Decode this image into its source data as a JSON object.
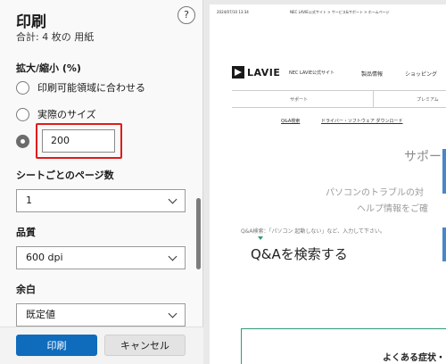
{
  "panel": {
    "title": "印刷",
    "subtitle": "合計: 4 枚の 用紙",
    "help_label": "?",
    "scale": {
      "label": "拡大/縮小 (%)",
      "options": [
        {
          "label": "印刷可能領域に合わせる",
          "checked": false
        },
        {
          "label": "実際のサイズ",
          "checked": false
        },
        {
          "label": "",
          "checked": true
        }
      ],
      "custom_value": "200"
    },
    "pages_per_sheet": {
      "label": "シートごとのページ数",
      "value": "1"
    },
    "quality": {
      "label": "品質",
      "value": "600 dpi"
    },
    "margins": {
      "label": "余白",
      "value": "既定値"
    },
    "print_button": "印刷",
    "cancel_button": "キャンセル"
  },
  "preview": {
    "header_left": "2024/07/10 13:34",
    "header_center": "NEC LAVIE公式サイト > サービス&サポート > ホームページ",
    "logo_text": "LAVIE",
    "site_name": "NEC LAVIE公式サイト",
    "nav_items": [
      "製品情報",
      "ショッピング"
    ],
    "subnav_items": [
      "サポート",
      "プレミアム"
    ],
    "links": [
      "Q&A検索",
      "ドライバー・ソフトウェア ダウンロード"
    ],
    "support_heading": "サポー",
    "tagline_line1": "パソコンのトラブルの対",
    "tagline_line2": "ヘルプ情報をご確",
    "search_hint": "Q&A検索：「パソコン 起動しない」など、入力して下さい。",
    "qa_title": "Q&Aを検索する",
    "faq_title": "よくある症状・"
  },
  "colors": {
    "primary_button": "#0f6cbd",
    "highlight_border": "#e01b1b",
    "accent_green": "#2e9a7a",
    "scroll_tab_blue": "#4a86c8"
  }
}
